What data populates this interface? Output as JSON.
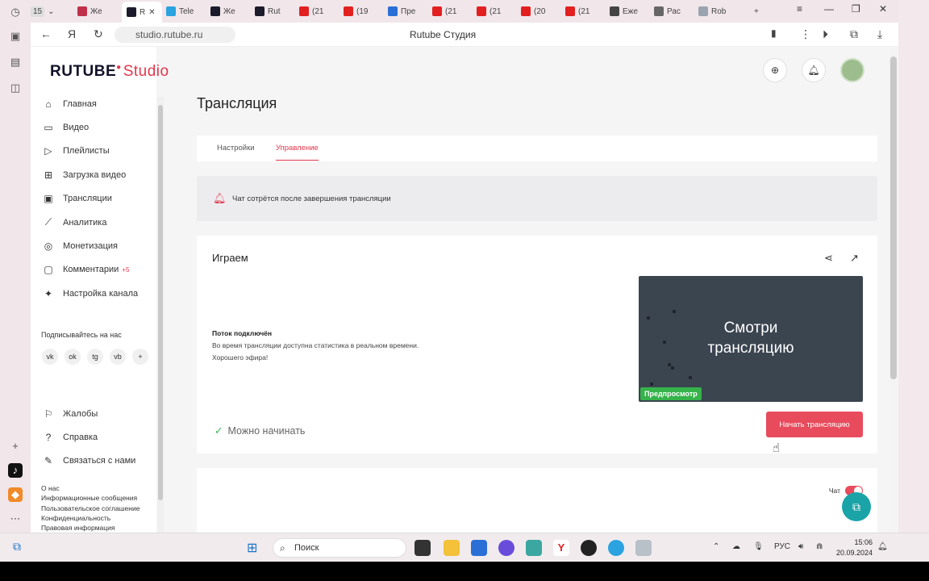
{
  "browser": {
    "tab_count": "15",
    "tabs": [
      {
        "label": "Же",
        "color": "#c0304a"
      },
      {
        "label": "R",
        "color": "#1b1b2b"
      },
      {
        "label": "Tele",
        "color": "#2aa3e0"
      },
      {
        "label": "Же",
        "color": "#1b1b2b"
      },
      {
        "label": "Rut",
        "color": "#1b1b2b"
      },
      {
        "label": "(21",
        "color": "#e22020"
      },
      {
        "label": "(19",
        "color": "#e22020"
      },
      {
        "label": "Пре",
        "color": "#2a6fd6"
      },
      {
        "label": "(21",
        "color": "#e22020"
      },
      {
        "label": "(21",
        "color": "#e22020"
      },
      {
        "label": "(20",
        "color": "#e22020"
      },
      {
        "label": "(21",
        "color": "#e22020"
      },
      {
        "label": "Еже",
        "color": "#444444"
      },
      {
        "label": "Рас",
        "color": "#666666"
      },
      {
        "label": "Rob",
        "color": "#9aa4b0"
      }
    ],
    "url": "studio.rutube.ru",
    "page_title": "Rutube Студия"
  },
  "logo": {
    "brand": "RUTUBE",
    "studio": "Studio"
  },
  "sidebar": {
    "items": [
      {
        "label": "Главная",
        "icon": "home-icon",
        "glyph": "⌂"
      },
      {
        "label": "Видео",
        "icon": "video-icon",
        "glyph": "▭"
      },
      {
        "label": "Плейлисты",
        "icon": "playlist-icon",
        "glyph": "▷"
      },
      {
        "label": "Загрузка видео",
        "icon": "upload-icon",
        "glyph": "⊞"
      },
      {
        "label": "Трансляции",
        "icon": "broadcast-icon",
        "glyph": "▣"
      },
      {
        "label": "Аналитика",
        "icon": "analytics-icon",
        "glyph": "⟋"
      },
      {
        "label": "Монетизация",
        "icon": "monetization-icon",
        "glyph": "◎"
      },
      {
        "label": "Комментарии",
        "icon": "comments-icon",
        "glyph": "▢",
        "badge": "+5"
      },
      {
        "label": "Настройка канала",
        "icon": "magic-wand-icon",
        "glyph": "✦"
      }
    ],
    "follow_title": "Подписывайтесь на нас",
    "social": [
      "vk",
      "ok",
      "tg",
      "vb",
      "+"
    ],
    "bottom_items": [
      {
        "label": "Жалобы",
        "icon": "flag-icon",
        "glyph": "⚐"
      },
      {
        "label": "Справка",
        "icon": "help-icon",
        "glyph": "?"
      },
      {
        "label": "Связаться с нами",
        "icon": "edit-icon",
        "glyph": "✎"
      }
    ],
    "footer_links": [
      "О нас",
      "Информационные сообщения",
      "Пользовательское соглашение",
      "Конфиденциальность",
      "Правовая информация"
    ]
  },
  "main": {
    "title": "Трансляция",
    "tabs": [
      "Настройки",
      "Управление"
    ],
    "notice": "Чат сотрётся после завершения трансляции",
    "stream_card": {
      "title": "Играем",
      "preview_text_line1": "Смотри",
      "preview_text_line2": "трансляцию",
      "preview_label": "Предпросмотр",
      "status_title": "Поток подключён",
      "status_line1": "Во время трансляции доступна статистика в реальном времени.",
      "status_line2": "Хорошего эфира!",
      "ready": "Можно начинать",
      "start_button": "Начать трансляцию"
    },
    "chat_label": "Чат"
  },
  "taskbar": {
    "search_label": "Поиск",
    "lang": "РУС",
    "time": "15:06",
    "date": "20.09.2024"
  },
  "colors": {
    "accent": "#e2364b",
    "success": "#35b34a",
    "help_fab": "#1aa4a7"
  }
}
